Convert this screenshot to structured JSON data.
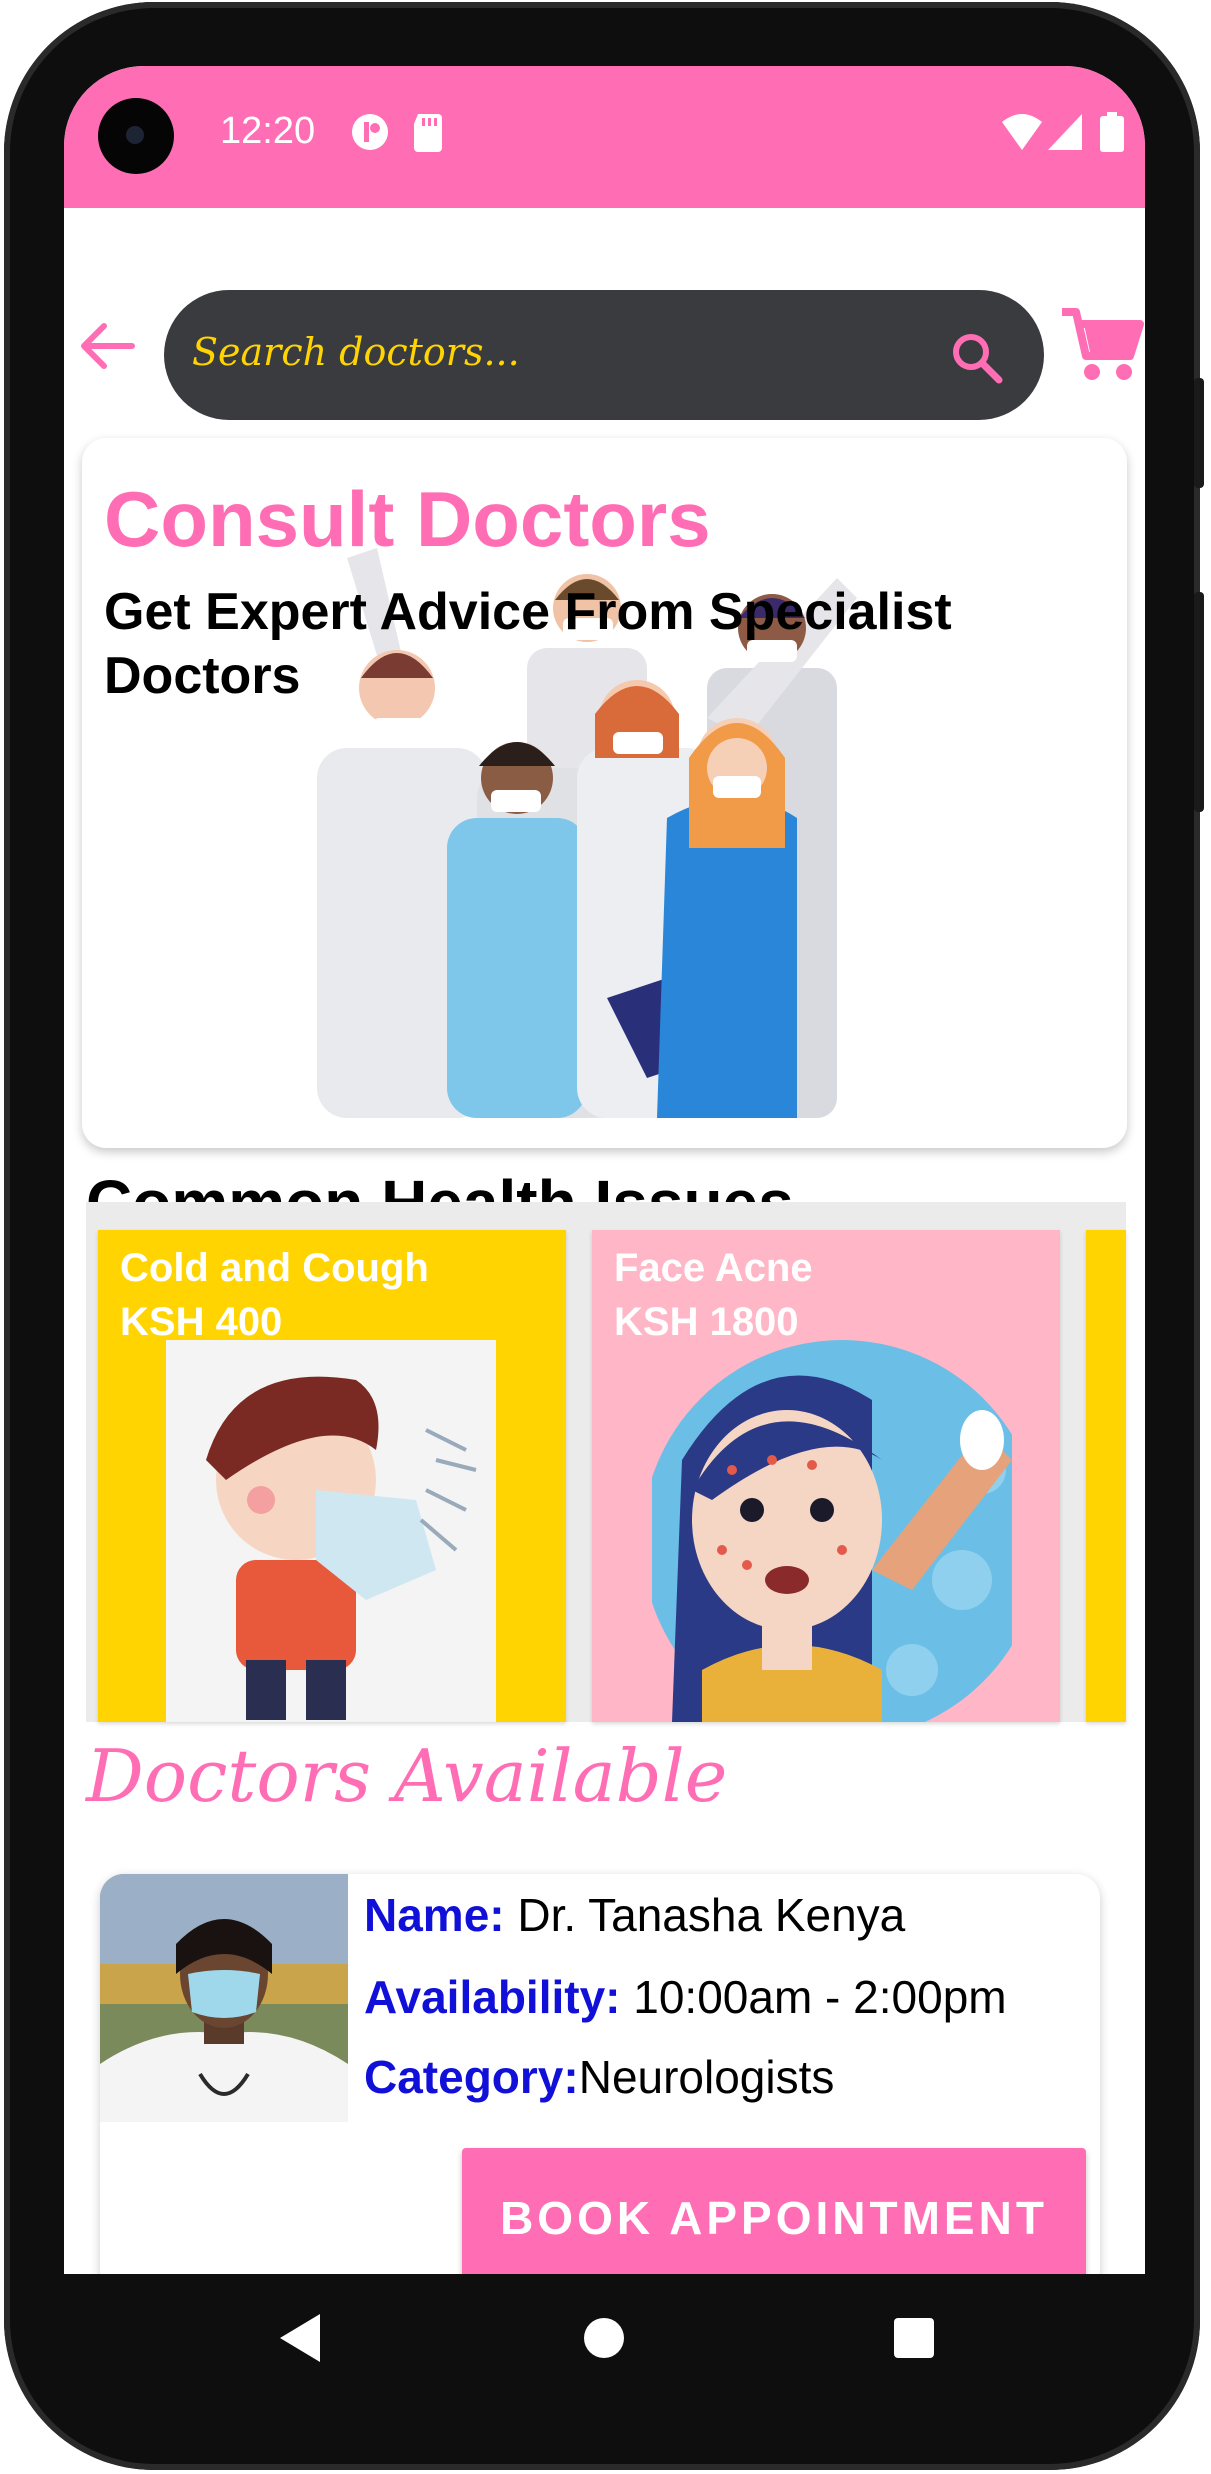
{
  "status_bar": {
    "time": "12:20"
  },
  "search": {
    "placeholder": "Search doctors..."
  },
  "banner": {
    "title": "Consult Doctors",
    "subtitle": "Get Expert Advice From Specialist Doctors"
  },
  "common_issues": {
    "title": "Common Health Issues",
    "items": [
      {
        "name": "Cold and Cough",
        "price": "KSH 400"
      },
      {
        "name": "Face Acne",
        "price": "KSH 1800"
      }
    ]
  },
  "doctors": {
    "title": "Doctors Available",
    "list": [
      {
        "name_key": "Name:",
        "name": "Dr. Tanasha Kenya",
        "availability_key": "Availability:",
        "availability": "10:00am - 2:00pm",
        "category_key": "Category:",
        "category": "Neurologists",
        "book_label": "BOOK APPOINTMENT"
      }
    ]
  },
  "colors": {
    "accent": "#ff6eb4",
    "search_bg": "#3a3b3f",
    "search_text": "#ffd400",
    "key_blue": "#1010d8",
    "card_yellow": "#ffd400",
    "card_pink": "#ffb6c6"
  },
  "icons": [
    "back-arrow-icon",
    "search-icon",
    "cart-icon",
    "wifi-icon",
    "signal-icon",
    "battery-icon",
    "nav-back-icon",
    "nav-home-icon",
    "nav-recents-icon"
  ]
}
